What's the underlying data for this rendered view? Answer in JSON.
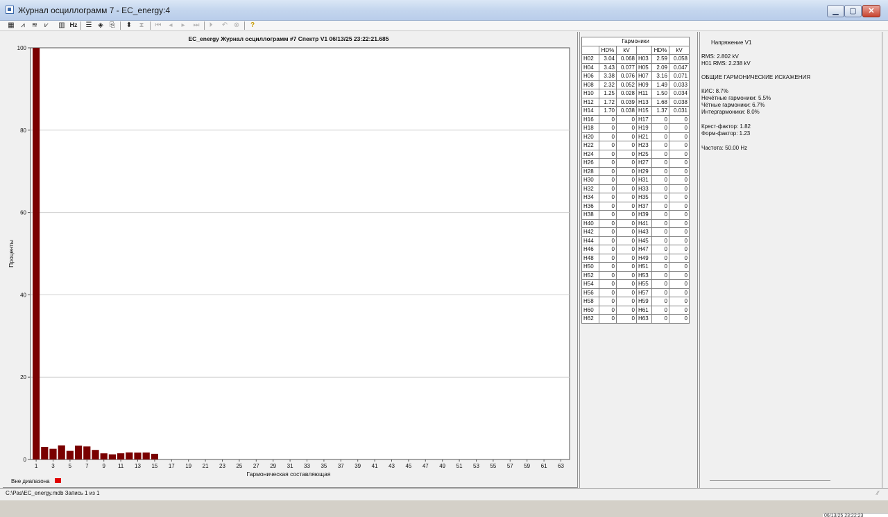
{
  "window": {
    "title": "Журнал осциллограмм 7 - EC_energy:4"
  },
  "toolbar": {
    "icons": [
      "table-icon",
      "chart-line-icon",
      "chart-multi-icon",
      "chart-area-icon",
      "bar-settings-icon",
      "hz-icon",
      "list-icon",
      "marker-icon",
      "export-icon",
      "expand-icon",
      "collapse-icon",
      "first-icon",
      "prev-icon",
      "next-icon",
      "last-icon",
      "play-icon",
      "undo-icon",
      "stop-icon",
      "help-icon"
    ],
    "hz_label": "Hz"
  },
  "chart_data": {
    "type": "bar",
    "title": "EC_energy  Журнал осциллограмм #7  Спектр V1  06/13/25  23:22:21.685",
    "xlabel": "Гармоническая составляющая",
    "ylabel": "Проценты",
    "ylim": [
      0,
      100
    ],
    "yticks": [
      "0",
      "20",
      "40",
      "60",
      "80",
      "100"
    ],
    "categories": [
      "1",
      "2",
      "3",
      "4",
      "5",
      "6",
      "7",
      "8",
      "9",
      "10",
      "11",
      "12",
      "13",
      "14",
      "15",
      "16",
      "17",
      "18",
      "19",
      "20",
      "21",
      "22",
      "23",
      "24",
      "25",
      "26",
      "27",
      "28",
      "29",
      "30",
      "31",
      "32",
      "33",
      "34",
      "35",
      "36",
      "37",
      "38",
      "39",
      "40",
      "41",
      "42",
      "43",
      "44",
      "45",
      "46",
      "47",
      "48",
      "49",
      "50",
      "51",
      "52",
      "53",
      "54",
      "55",
      "56",
      "57",
      "58",
      "59",
      "60",
      "61",
      "62",
      "63"
    ],
    "xtick_labels": [
      "1",
      "3",
      "5",
      "7",
      "9",
      "11",
      "13",
      "15",
      "17",
      "19",
      "21",
      "23",
      "25",
      "27",
      "29",
      "31",
      "33",
      "35",
      "37",
      "39",
      "41",
      "43",
      "45",
      "47",
      "49",
      "51",
      "53",
      "55",
      "57",
      "59",
      "61",
      "63"
    ],
    "values": [
      100,
      3.04,
      2.59,
      3.43,
      2.09,
      3.38,
      3.16,
      2.32,
      1.49,
      1.25,
      1.5,
      1.72,
      1.68,
      1.7,
      1.37,
      0,
      0,
      0,
      0,
      0,
      0,
      0,
      0,
      0,
      0,
      0,
      0,
      0,
      0,
      0,
      0,
      0,
      0,
      0,
      0,
      0,
      0,
      0,
      0,
      0,
      0,
      0,
      0,
      0,
      0,
      0,
      0,
      0,
      0,
      0,
      0,
      0,
      0,
      0,
      0,
      0,
      0,
      0,
      0,
      0,
      0,
      0,
      0
    ],
    "bar_color": "#7a0000",
    "grid": true,
    "legend": {
      "label": "Вне диапазона",
      "color": "#e00000",
      "placement": "bottom-left"
    }
  },
  "harmonics": {
    "title": "Гармоники",
    "headers": [
      "",
      "HD%",
      "kV",
      "",
      "HD%",
      "kV"
    ],
    "rows": [
      [
        "H02",
        "3.04",
        "0.068",
        "H03",
        "2.59",
        "0.058"
      ],
      [
        "H04",
        "3.43",
        "0.077",
        "H05",
        "2.09",
        "0.047"
      ],
      [
        "H06",
        "3.38",
        "0.076",
        "H07",
        "3.16",
        "0.071"
      ],
      [
        "H08",
        "2.32",
        "0.052",
        "H09",
        "1.49",
        "0.033"
      ],
      [
        "H10",
        "1.25",
        "0.028",
        "H11",
        "1.50",
        "0.034"
      ],
      [
        "H12",
        "1.72",
        "0.039",
        "H13",
        "1.68",
        "0.038"
      ],
      [
        "H14",
        "1.70",
        "0.038",
        "H15",
        "1.37",
        "0.031"
      ],
      [
        "H16",
        "0",
        "0",
        "H17",
        "0",
        "0"
      ],
      [
        "H18",
        "0",
        "0",
        "H19",
        "0",
        "0"
      ],
      [
        "H20",
        "0",
        "0",
        "H21",
        "0",
        "0"
      ],
      [
        "H22",
        "0",
        "0",
        "H23",
        "0",
        "0"
      ],
      [
        "H24",
        "0",
        "0",
        "H25",
        "0",
        "0"
      ],
      [
        "H26",
        "0",
        "0",
        "H27",
        "0",
        "0"
      ],
      [
        "H28",
        "0",
        "0",
        "H29",
        "0",
        "0"
      ],
      [
        "H30",
        "0",
        "0",
        "H31",
        "0",
        "0"
      ],
      [
        "H32",
        "0",
        "0",
        "H33",
        "0",
        "0"
      ],
      [
        "H34",
        "0",
        "0",
        "H35",
        "0",
        "0"
      ],
      [
        "H36",
        "0",
        "0",
        "H37",
        "0",
        "0"
      ],
      [
        "H38",
        "0",
        "0",
        "H39",
        "0",
        "0"
      ],
      [
        "H40",
        "0",
        "0",
        "H41",
        "0",
        "0"
      ],
      [
        "H42",
        "0",
        "0",
        "H43",
        "0",
        "0"
      ],
      [
        "H44",
        "0",
        "0",
        "H45",
        "0",
        "0"
      ],
      [
        "H46",
        "0",
        "0",
        "H47",
        "0",
        "0"
      ],
      [
        "H48",
        "0",
        "0",
        "H49",
        "0",
        "0"
      ],
      [
        "H50",
        "0",
        "0",
        "H51",
        "0",
        "0"
      ],
      [
        "H52",
        "0",
        "0",
        "H53",
        "0",
        "0"
      ],
      [
        "H54",
        "0",
        "0",
        "H55",
        "0",
        "0"
      ],
      [
        "H56",
        "0",
        "0",
        "H57",
        "0",
        "0"
      ],
      [
        "H58",
        "0",
        "0",
        "H59",
        "0",
        "0"
      ],
      [
        "H60",
        "0",
        "0",
        "H61",
        "0",
        "0"
      ],
      [
        "H62",
        "0",
        "0",
        "H63",
        "0",
        "0"
      ]
    ]
  },
  "info": {
    "title": "Напряжение V1",
    "rms": "RMS: 2.802 kV",
    "h01_rms": "H01 RMS: 2.238 kV",
    "thd_header": "ОБЩИЕ ГАРМОНИЧЕСКИЕ ИСКАЖЕНИЯ",
    "kis": "КИС: 8.7%",
    "odd": "Нечётные гармоники: 5.5%",
    "even": "Чётные гармоники: 6.7%",
    "inter": "Интергармоники:  8.0%",
    "crest": "Крест-фактор: 1.82",
    "form": "Форм-фактор: 1.23",
    "freq": "Частота: 50.00 Hz"
  },
  "status": {
    "text": "C:\\Pas\\EC_energy.mdb  Запись 1 из 1"
  },
  "taskbar": {
    "clock": "06/13/25 23:22:23"
  }
}
